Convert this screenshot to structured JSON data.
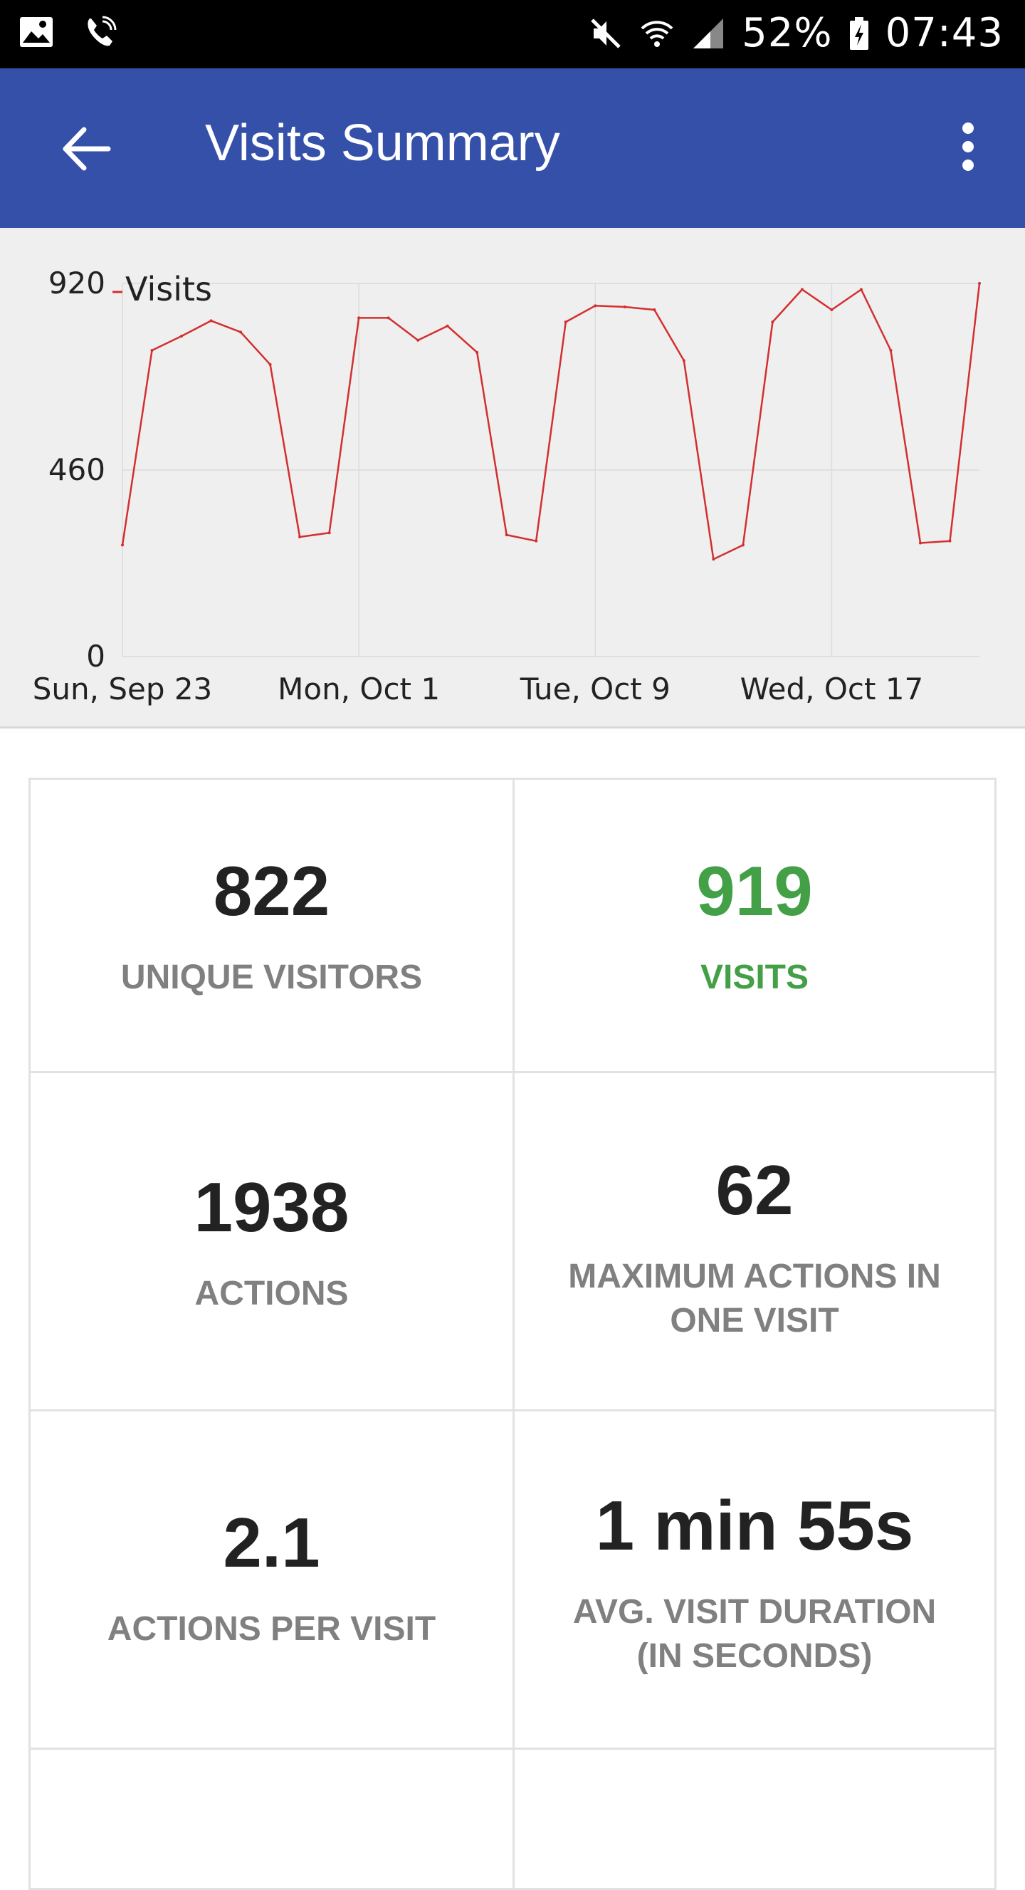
{
  "status_bar": {
    "battery": "52%",
    "time": "07:43",
    "icons": [
      "image-icon",
      "wifi-call-icon",
      "mute-icon",
      "wifi-icon",
      "signal-icon",
      "battery-icon"
    ]
  },
  "app_bar": {
    "title": "Visits Summary",
    "back_icon": "arrow-back-icon",
    "menu_icon": "more-vert-icon",
    "background": "#3550a8"
  },
  "chart_data": {
    "type": "line",
    "legend": "Visits",
    "legend_placement": "top-left",
    "series_color": "#d32f2f",
    "ylim": [
      0,
      920
    ],
    "y_ticks": [
      "0",
      "460",
      "920"
    ],
    "x_tick_labels": [
      "Sun, Sep 23",
      "Mon, Oct 1",
      "Tue, Oct 9",
      "Wed, Oct 17"
    ],
    "grid": true,
    "series": [
      {
        "name": "Visits",
        "x": [
          "2018-09-23",
          "2018-09-24",
          "2018-09-25",
          "2018-09-26",
          "2018-09-27",
          "2018-09-28",
          "2018-09-29",
          "2018-09-30",
          "2018-10-01",
          "2018-10-02",
          "2018-10-03",
          "2018-10-04",
          "2018-10-05",
          "2018-10-06",
          "2018-10-07",
          "2018-10-08",
          "2018-10-09",
          "2018-10-10",
          "2018-10-11",
          "2018-10-12",
          "2018-10-13",
          "2018-10-14",
          "2018-10-15",
          "2018-10-16",
          "2018-10-17",
          "2018-10-18",
          "2018-10-19",
          "2018-10-20",
          "2018-10-21",
          "2018-10-22"
        ],
        "values": [
          275,
          755,
          790,
          828,
          800,
          720,
          295,
          305,
          835,
          835,
          780,
          815,
          750,
          300,
          285,
          825,
          865,
          862,
          855,
          730,
          240,
          275,
          825,
          905,
          855,
          905,
          755,
          280,
          285,
          920
        ]
      }
    ]
  },
  "stats": [
    {
      "value": "822",
      "label": "UNIQUE VISITORS",
      "highlight": false
    },
    {
      "value": "919",
      "label": "VISITS",
      "highlight": true
    },
    {
      "value": "1938",
      "label": "ACTIONS",
      "highlight": false
    },
    {
      "value": "62",
      "label_line1": "MAXIMUM ACTIONS IN",
      "label_line2": "ONE VISIT",
      "highlight": false
    },
    {
      "value": "2.1",
      "label": "ACTIONS PER VISIT",
      "highlight": false
    },
    {
      "value": "1 min 55s",
      "label_line1": "AVG. VISIT DURATION",
      "label_line2": "(IN SECONDS)",
      "highlight": false
    }
  ],
  "colors": {
    "highlight": "#43a047",
    "value_text": "#222222",
    "label_text": "#808080"
  }
}
